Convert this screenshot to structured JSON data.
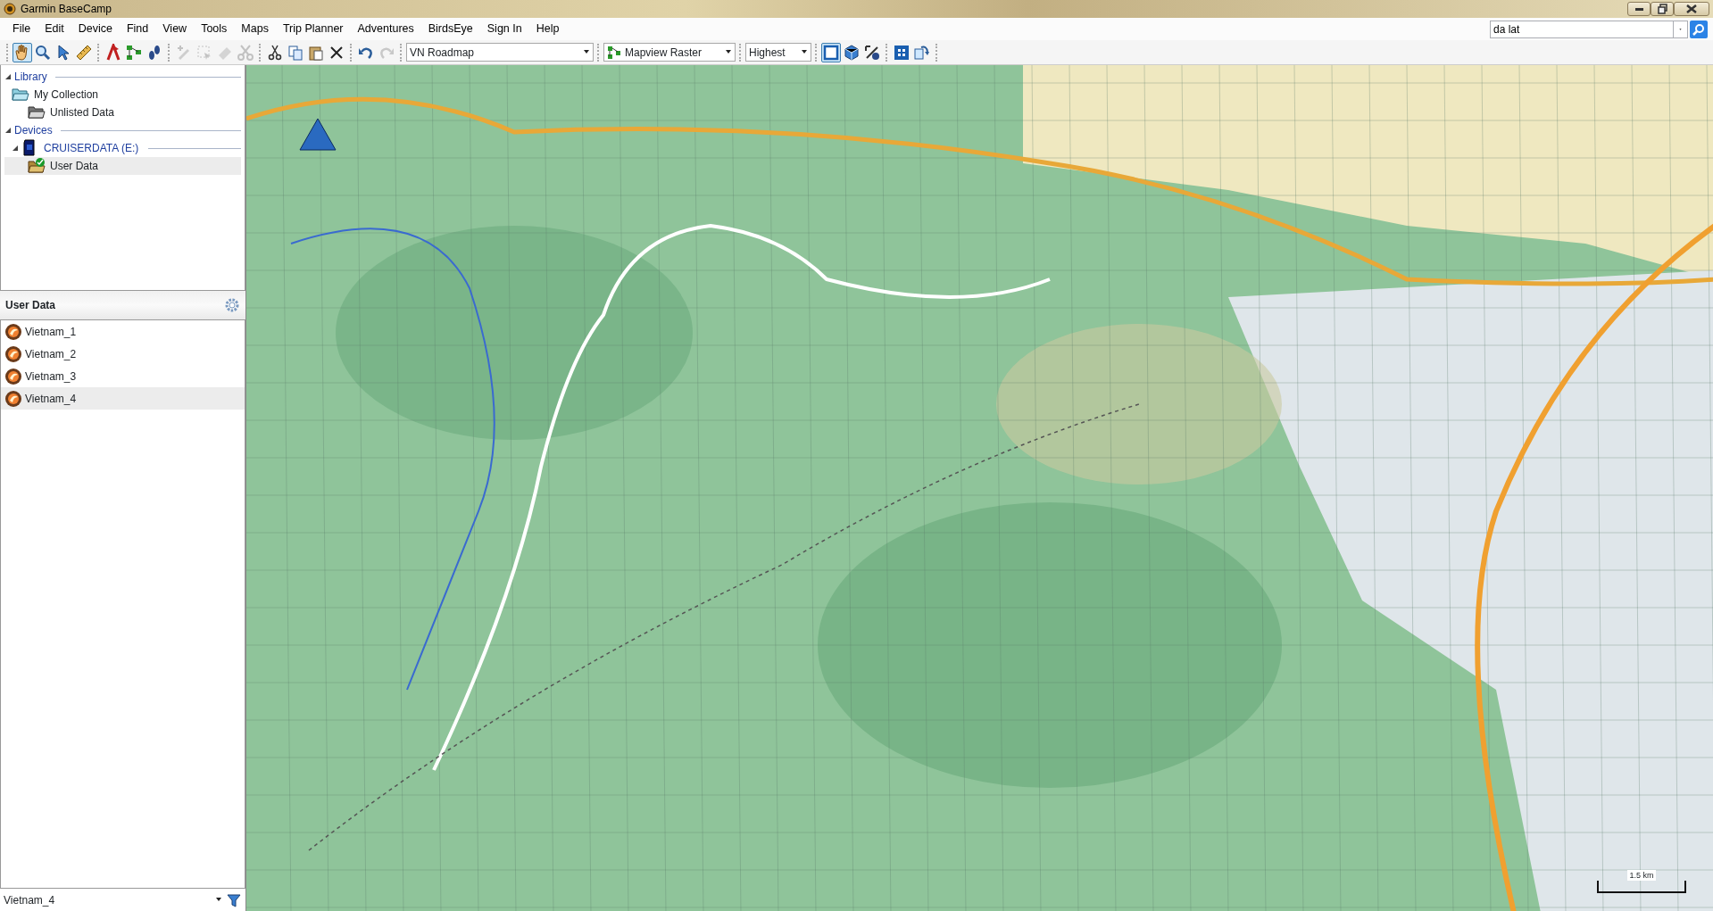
{
  "window": {
    "title": "Garmin BaseCamp"
  },
  "menu": [
    "File",
    "Edit",
    "Device",
    "Find",
    "View",
    "Tools",
    "Maps",
    "Trip Planner",
    "Adventures",
    "BirdsEye",
    "Sign In",
    "Help"
  ],
  "search": {
    "value": "da lat"
  },
  "toolbar": {
    "tools": [
      {
        "selected": true,
        "disabled": false
      },
      {
        "selected": false,
        "disabled": false
      },
      {
        "selected": false,
        "disabled": false
      },
      {
        "selected": false,
        "disabled": false
      },
      {
        "selected": false,
        "disabled": false
      },
      {
        "selected": false,
        "disabled": false
      },
      {
        "selected": false,
        "disabled": false
      },
      {
        "selected": false,
        "disabled": true
      },
      {
        "selected": false,
        "disabled": true
      },
      {
        "selected": false,
        "disabled": true
      },
      {
        "selected": false,
        "disabled": true
      },
      {
        "selected": false,
        "disabled": false
      },
      {
        "selected": false,
        "disabled": false
      },
      {
        "selected": false,
        "disabled": false
      },
      {
        "selected": false,
        "disabled": false
      },
      {
        "selected": false,
        "disabled": false
      },
      {
        "selected": false,
        "disabled": true
      }
    ],
    "map_product": "VN Roadmap",
    "map_style": "Mapview Raster",
    "detail": "Highest",
    "view_tools": [
      {
        "selected": true
      },
      {
        "selected": false
      },
      {
        "selected": false
      },
      {
        "selected": false
      },
      {
        "selected": false
      }
    ]
  },
  "library": {
    "sections": [
      {
        "label": "Library",
        "expanded": true,
        "items": [
          {
            "label": "My Collection",
            "kind": "collection",
            "selected": false,
            "children": [
              {
                "label": "Unlisted Data",
                "kind": "folder",
                "selected": false
              }
            ]
          }
        ]
      },
      {
        "label": "Devices",
        "expanded": true,
        "items": [
          {
            "label": "CRUISERDATA (E:)",
            "kind": "device",
            "expanded": true,
            "selected": false,
            "children": [
              {
                "label": "User Data",
                "kind": "userdata",
                "selected": true
              }
            ]
          }
        ]
      }
    ]
  },
  "user_data": {
    "title": "User Data",
    "items": [
      {
        "label": "Vietnam_1",
        "selected": false
      },
      {
        "label": "Vietnam_2",
        "selected": false
      },
      {
        "label": "Vietnam_3",
        "selected": false
      },
      {
        "label": "Vietnam_4",
        "selected": true
      }
    ],
    "filter_value": "Vietnam_4"
  },
  "map": {
    "scale": "1.5 km"
  }
}
